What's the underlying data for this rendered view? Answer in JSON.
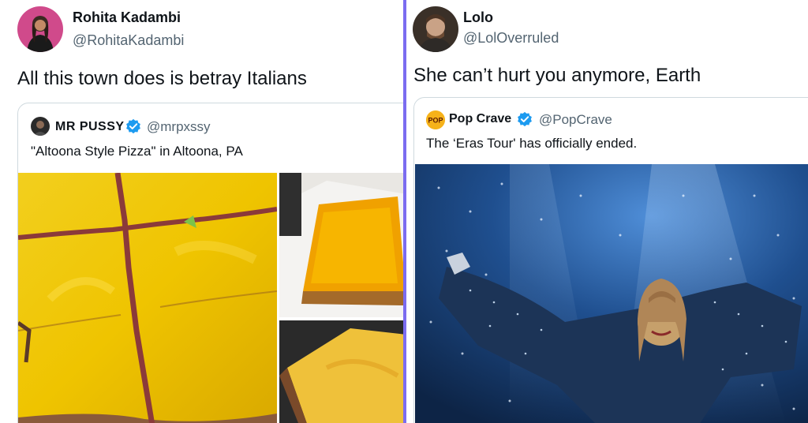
{
  "left_tweet": {
    "author_name": "Rohita Kadambi",
    "author_handle": "@RohitaKadambi",
    "text": "All this town does is betray Italians",
    "quote": {
      "author_name": "MR PUSSY",
      "author_handle": "@mrpxssy",
      "text": "\"Altoona Style Pizza\" in Altoona, PA",
      "verified": true
    }
  },
  "right_tweet": {
    "author_name": "Lolo",
    "author_handle": "@LolOverruled",
    "text": "She can’t hurt you anymore, Earth",
    "quote": {
      "author_name": "Pop Crave",
      "author_handle": "@PopCrave",
      "text": "The ‘Eras Tour' has officially ended.",
      "verified": true,
      "logo_text": "POP"
    }
  },
  "colors": {
    "divider": "#7b6cf0",
    "verified": "#1d9bf0",
    "handle": "#536471",
    "border": "#cfd9de"
  },
  "icons": {
    "verified": "verified-badge-icon"
  }
}
